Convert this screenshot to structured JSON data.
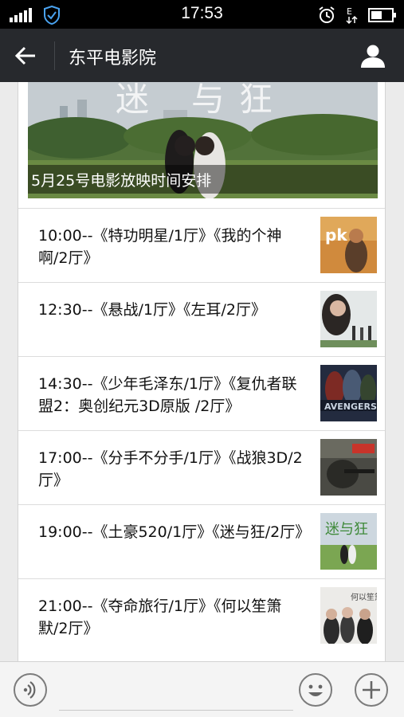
{
  "status_bar": {
    "time": "17:53"
  },
  "header": {
    "title": "东平电影院"
  },
  "cover": {
    "caption": "5月25号电影放映时间安排"
  },
  "schedule": [
    {
      "text": "10:00--《特功明星/1厅》《我的个神啊/2厅》",
      "thumb_color": "#c47a2e"
    },
    {
      "text": "12:30--《悬战/1厅》《左耳/2厅》",
      "thumb_color": "#d9dfe0"
    },
    {
      "text": "14:30--《少年毛泽东/1厅》《复仇者联盟2：奥创纪元3D原版 /2厅》",
      "thumb_color": "#2a3348"
    },
    {
      "text": "17:00--《分手不分手/1厅》《战狼3D/2厅》",
      "thumb_color": "#3e3e3a"
    },
    {
      "text": "19:00--《土豪520/1厅》《迷与狂/2厅》",
      "thumb_color": "#7fa55a"
    },
    {
      "text": "21:00--《夺命旅行/1厅》《何以笙箫默/2厅》",
      "thumb_color": "#e8e6e4"
    }
  ],
  "input_bar": {
    "placeholder": ""
  }
}
